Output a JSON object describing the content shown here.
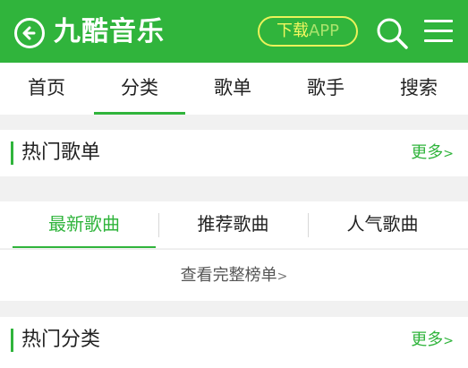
{
  "header": {
    "brand": "九酷音乐",
    "download": {
      "part1": "下载",
      "part2": "APP"
    },
    "icons": {
      "back": "back-arrow-icon",
      "search": "search-icon",
      "menu": "menu-icon"
    },
    "colors": {
      "accent": "#30b43c",
      "download_border": "#ecf25a"
    }
  },
  "nav": {
    "items": [
      {
        "label": "首页"
      },
      {
        "label": "分类"
      },
      {
        "label": "歌单"
      },
      {
        "label": "歌手"
      },
      {
        "label": "搜索"
      }
    ],
    "active": "分类"
  },
  "hot_playlists": {
    "title": "热门歌单",
    "more": "更多",
    "more_chevron": ">"
  },
  "song_tabs": {
    "items": [
      {
        "label": "最新歌曲"
      },
      {
        "label": "推荐歌曲"
      },
      {
        "label": "人气歌曲"
      }
    ],
    "active": "最新歌曲"
  },
  "full_rank": {
    "label": "查看完整榜单",
    "chevron": ">"
  },
  "hot_categories": {
    "title": "热门分类",
    "more": "更多",
    "more_chevron": ">"
  }
}
